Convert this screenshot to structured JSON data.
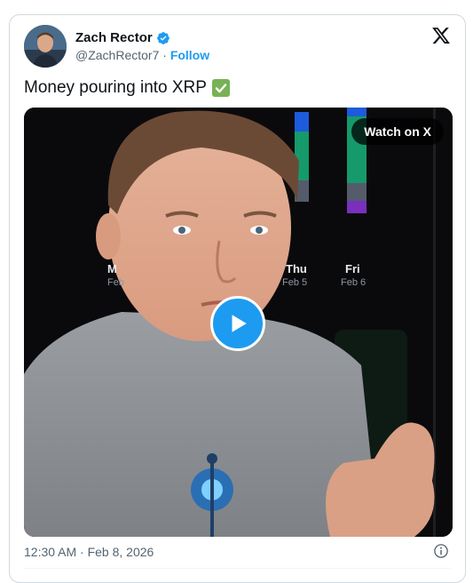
{
  "tweet": {
    "author_name": "Zach Rector",
    "handle": "@ZachRector7",
    "separator": "·",
    "follow_label": "Follow",
    "text": "Money pouring into XRP",
    "emoji": "check-mark-button",
    "timestamp": "12:30 AM · Feb 8, 2026"
  },
  "media": {
    "watch_label": "Watch on X",
    "chart_overlay": {
      "day_labels": [
        "M",
        "Thu",
        "Fri"
      ],
      "date_labels": [
        "Feb",
        "Feb 5",
        "Feb 6"
      ]
    }
  },
  "colors": {
    "accent": "#1d9bf0",
    "verified": "#1d9bf0",
    "check_emoji": "#77b255"
  },
  "icons": {
    "verified": "verified-badge-icon",
    "logo": "x-logo-icon",
    "play": "play-icon",
    "info": "info-icon"
  }
}
